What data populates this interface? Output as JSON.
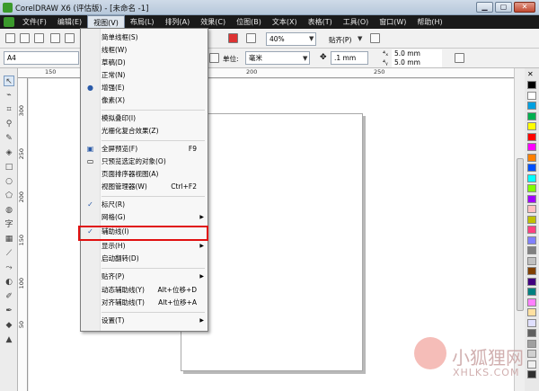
{
  "window": {
    "title": "CorelDRAW X6 (评估版) - [未命名 -1]",
    "buttons": {
      "minimize": "▁",
      "restore": "▢",
      "close": "✕"
    }
  },
  "menubar": {
    "items": [
      {
        "label": "文件(F)"
      },
      {
        "label": "编辑(E)"
      },
      {
        "label": "视图(V)"
      },
      {
        "label": "布局(L)"
      },
      {
        "label": "排列(A)"
      },
      {
        "label": "效果(C)"
      },
      {
        "label": "位图(B)"
      },
      {
        "label": "文本(X)"
      },
      {
        "label": "表格(T)"
      },
      {
        "label": "工具(O)"
      },
      {
        "label": "窗口(W)"
      },
      {
        "label": "帮助(H)"
      }
    ]
  },
  "toolbar1": {
    "zoom_value": "40%",
    "snap_label": "贴齐(P)"
  },
  "toolbar2": {
    "page_size": "A4",
    "units_label": "单位:",
    "units_value": "毫米",
    "nudge_value": ".1 mm",
    "dup_x": "5.0 mm",
    "dup_y": "5.0 mm"
  },
  "ruler": {
    "h_ticks": [
      "150",
      "200",
      "250"
    ],
    "v_ticks": [
      "300",
      "250",
      "200",
      "150",
      "100",
      "50"
    ]
  },
  "view_menu": {
    "items": [
      {
        "label": "简单线框(S)",
        "shortcut": "",
        "icon": "",
        "submenu": false
      },
      {
        "label": "线框(W)",
        "shortcut": "",
        "icon": "",
        "submenu": false
      },
      {
        "label": "草稿(D)",
        "shortcut": "",
        "icon": "",
        "submenu": false
      },
      {
        "label": "正常(N)",
        "shortcut": "",
        "icon": "",
        "submenu": false
      },
      {
        "label": "增强(E)",
        "shortcut": "",
        "icon": "radio-dot",
        "submenu": false
      },
      {
        "label": "像素(X)",
        "shortcut": "",
        "icon": "",
        "submenu": false
      },
      {
        "label": "模拟叠印(I)",
        "shortcut": "",
        "icon": "",
        "submenu": false
      },
      {
        "label": "光栅化复合效果(Z)",
        "shortcut": "",
        "icon": "",
        "submenu": false
      },
      {
        "label": "全屏预览(F)",
        "shortcut": "F9",
        "icon": "fullscreen",
        "submenu": false
      },
      {
        "label": "只预览选定的对象(O)",
        "shortcut": "",
        "icon": "monitor",
        "submenu": false
      },
      {
        "label": "页面排序器视图(A)",
        "shortcut": "",
        "icon": "",
        "submenu": false
      },
      {
        "label": "视图管理器(W)",
        "shortcut": "Ctrl+F2",
        "icon": "",
        "submenu": false
      },
      {
        "label": "标尺(R)",
        "shortcut": "",
        "icon": "check",
        "submenu": false
      },
      {
        "label": "网格(G)",
        "shortcut": "",
        "icon": "",
        "submenu": true
      },
      {
        "label": "辅助线(I)",
        "shortcut": "",
        "icon": "check",
        "submenu": false
      },
      {
        "label": "显示(H)",
        "shortcut": "",
        "icon": "",
        "submenu": true
      },
      {
        "label": "启动翻转(D)",
        "shortcut": "",
        "icon": "",
        "submenu": false
      },
      {
        "label": "贴齐(P)",
        "shortcut": "",
        "icon": "",
        "submenu": true
      },
      {
        "label": "动态辅助线(Y)",
        "shortcut": "Alt+位移+D",
        "icon": "",
        "submenu": false
      },
      {
        "label": "对齐辅助线(T)",
        "shortcut": "Alt+位移+A",
        "icon": "",
        "submenu": false
      },
      {
        "label": "设置(T)",
        "shortcut": "",
        "icon": "",
        "submenu": true
      }
    ]
  },
  "watermark": {
    "text": "小狐狸网",
    "url": "XHLKS.COM"
  },
  "colors": {
    "menubar_bg": "#1a1a1a",
    "highlight_border": "#e01010",
    "palette": [
      "#000000",
      "#ffffff",
      "#00a0e0",
      "#00b050",
      "#ffff00",
      "#ff0000",
      "#ff00ff",
      "#ff8000",
      "#0050ff",
      "#00ffff",
      "#80ff00",
      "#a000ff",
      "#ffc0c0",
      "#c0c000",
      "#ff4080",
      "#8080ff",
      "#808080",
      "#c0c0c0",
      "#804000",
      "#400080",
      "#008080",
      "#ff80ff",
      "#ffe0a0",
      "#e0e0ff",
      "#606060",
      "#a0a0a0",
      "#d0d0d0",
      "#f0f0f0",
      "#303030"
    ]
  }
}
